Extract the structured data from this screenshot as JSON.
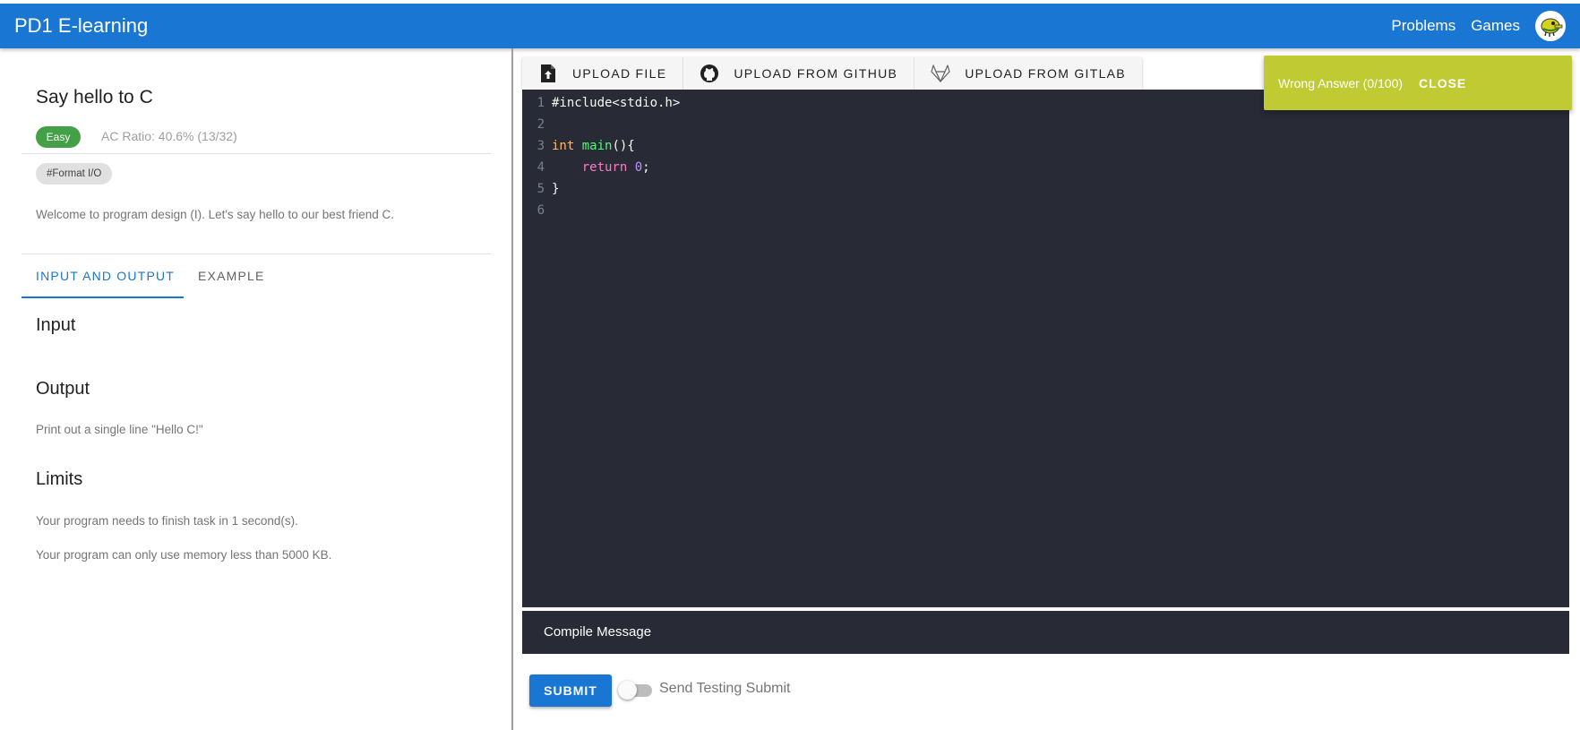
{
  "appbar": {
    "title": "PD1 E-learning",
    "nav": [
      "Problems",
      "Games"
    ],
    "color": "#1976d2"
  },
  "problem": {
    "title": "Say hello to C",
    "difficulty": "Easy",
    "ac_ratio": "AC Ratio: 40.6% (13/32)",
    "tag": "#Format I/O",
    "description": "Welcome to program design (I). Let's say hello to our best friend C."
  },
  "tabs": [
    {
      "label": "INPUT AND OUTPUT",
      "active": true
    },
    {
      "label": "EXAMPLE",
      "active": false
    }
  ],
  "sections": {
    "input_heading": "Input",
    "output_heading": "Output",
    "output_text": "Print out a single line \"Hello C!\"",
    "limits_heading": "Limits",
    "limit_time": "Your program needs to finish task in 1 second(s).",
    "limit_memory": "Your program can only use memory less than 5000 KB."
  },
  "upload": {
    "file": "UPLOAD FILE",
    "github": "UPLOAD FROM GITHUB",
    "gitlab": "UPLOAD FROM GITLAB"
  },
  "editor": {
    "line_numbers": [
      "1",
      "2",
      "3",
      "4",
      "5",
      "6"
    ],
    "line1": "#include<stdio.h>",
    "line3_type": "int",
    "line3_fn": "main",
    "line3_rest": "(){",
    "line4_kw": "return",
    "line4_num": "0",
    "line4_end": ";",
    "line5": "}",
    "theme_bg": "#282a36"
  },
  "compile_label": "Compile Message",
  "submit": {
    "button": "SUBMIT",
    "switch_label": "Send Testing Submit",
    "switch_on": false
  },
  "snackbar": {
    "message": "Wrong Answer (0/100)",
    "action": "CLOSE",
    "color": "#c0ca33"
  }
}
